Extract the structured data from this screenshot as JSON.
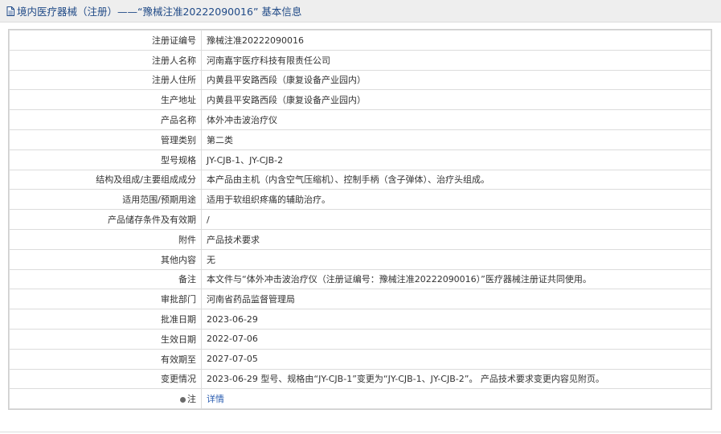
{
  "header": {
    "title": "境内医疗器械（注册）——“豫械注准20222090016” 基本信息",
    "icon": "document-icon",
    "color": "#204a87"
  },
  "rows": [
    {
      "label": "注册证编号",
      "value": "豫械注准20222090016"
    },
    {
      "label": "注册人名称",
      "value": "河南嘉宇医疗科技有限责任公司"
    },
    {
      "label": "注册人住所",
      "value": "内黄县平安路西段（康复设备产业园内）"
    },
    {
      "label": "生产地址",
      "value": "内黄县平安路西段（康复设备产业园内）"
    },
    {
      "label": "产品名称",
      "value": "体外冲击波治疗仪"
    },
    {
      "label": "管理类别",
      "value": "第二类"
    },
    {
      "label": "型号规格",
      "value": "JY-CJB-1、JY-CJB-2"
    },
    {
      "label": "结构及组成/主要组成成分",
      "value": "本产品由主机（内含空气压缩机）、控制手柄（含子弹体）、治疗头组成。"
    },
    {
      "label": "适用范围/预期用途",
      "value": "适用于软组织疼痛的辅助治疗。"
    },
    {
      "label": "产品储存条件及有效期",
      "value": "/"
    },
    {
      "label": "附件",
      "value": "产品技术要求"
    },
    {
      "label": "其他内容",
      "value": "无"
    },
    {
      "label": "备注",
      "value": "本文件与“体外冲击波治疗仪（注册证编号：豫械注准20222090016）”医疗器械注册证共同使用。"
    },
    {
      "label": "审批部门",
      "value": "河南省药品监督管理局"
    },
    {
      "label": "批准日期",
      "value": "2023-06-29"
    },
    {
      "label": "生效日期",
      "value": "2022-07-06"
    },
    {
      "label": "有效期至",
      "value": "2027-07-05"
    },
    {
      "label": "变更情况",
      "value": "2023-06-29 型号、规格由“JY-CJB-1”变更为“JY-CJB-1、JY-CJB-2”。 产品技术要求变更内容见附页。"
    }
  ],
  "note": {
    "label": "注",
    "icon": "notice-icon",
    "link_text": "详情"
  }
}
